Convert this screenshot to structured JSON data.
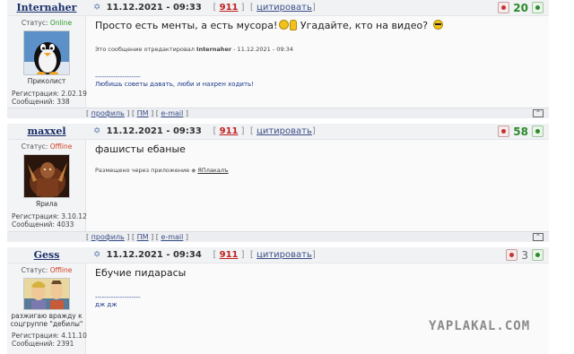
{
  "posts": [
    {
      "username": "Internaher",
      "status_label": "Статус:",
      "status_value": "Online",
      "user_title": "Приколист",
      "reg_label": "Регистрация:",
      "reg_date": "2.02.19",
      "posts_label": "Сообщений:",
      "posts_count": "338",
      "date": "11.12.2021 - 09:33",
      "post_number": "911",
      "quote_label": "цитировать",
      "rating": "20",
      "message_parts": [
        "Просто есть менты, а есть мусора!",
        "Угадайте, кто на видео?"
      ],
      "edited_note": "Это сообщение отредактировал",
      "edited_by": "Internaher",
      "edited_date": "- 11.12.2021 - 09:34",
      "sig_line": "--------------------",
      "sig_text": "Любишь советы давать, люби и нахрен ходить!",
      "profile_label": "профиль",
      "pm_label": "ПМ",
      "email_label": "e-mail",
      "up_label": "^"
    },
    {
      "username": "maxxel",
      "status_label": "Статус:",
      "status_value": "Offline",
      "user_title": "Ярила",
      "reg_label": "Регистрация:",
      "reg_date": "3.10.12",
      "posts_label": "Сообщений:",
      "posts_count": "4033",
      "date": "11.12.2021 - 09:33",
      "post_number": "911",
      "quote_label": "цитировать",
      "rating": "58",
      "message": "фашисты ебаные",
      "app_note": "Размещено через приложение",
      "app_name": "ЯПлакалъ",
      "profile_label": "профиль",
      "pm_label": "ПМ",
      "email_label": "e-mail",
      "up_label": "^"
    },
    {
      "username": "Gess",
      "status_label": "Статус:",
      "status_value": "Offline",
      "user_title_1": "разжигаю вражду к",
      "user_title_2": "соцгруппе \"дебилы\"",
      "reg_label": "Регистрация:",
      "reg_date": "4.11.10",
      "posts_label": "Сообщений:",
      "posts_count": "2391",
      "date": "11.12.2021 - 09:34",
      "post_number": "911",
      "quote_label": "цитировать",
      "rating": "3",
      "message": "Ебучие пидарасы",
      "sig_line": "--------------------",
      "sig_text": "дж дж"
    }
  ],
  "watermark": "YAPLAKAL.COM",
  "colors": {
    "online": "#2a9a2a",
    "offline": "#d04020",
    "rating_green": "#2a8a2a",
    "username": "#1a2e6a",
    "link": "#3b4f88"
  }
}
